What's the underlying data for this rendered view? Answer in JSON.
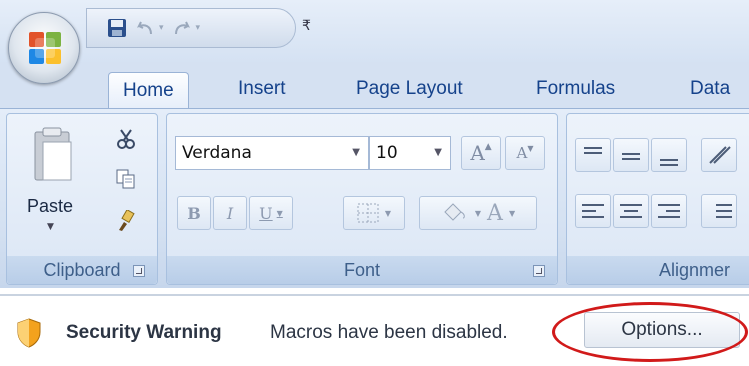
{
  "tabs": [
    {
      "label": "Home"
    },
    {
      "label": "Insert"
    },
    {
      "label": "Page Layout"
    },
    {
      "label": "Formulas"
    },
    {
      "label": "Data"
    }
  ],
  "ribbon": {
    "clipboard": {
      "paste_label": "Paste",
      "group_label": "Clipboard"
    },
    "font": {
      "font_name": "Verdana",
      "font_size": "10",
      "bold": "B",
      "italic": "I",
      "underline": "U",
      "font_color": "A",
      "grow": "A",
      "shrink": "A",
      "group_label": "Font"
    },
    "alignment": {
      "group_label": "Alignmer"
    }
  },
  "security_bar": {
    "title": "Security Warning",
    "message": "Macros have been disabled.",
    "options_label": "Options..."
  },
  "colors": {
    "tab_text": "#15428b",
    "ribbon_bg": "#d3e0f1",
    "highlight": "#d11a1a"
  }
}
